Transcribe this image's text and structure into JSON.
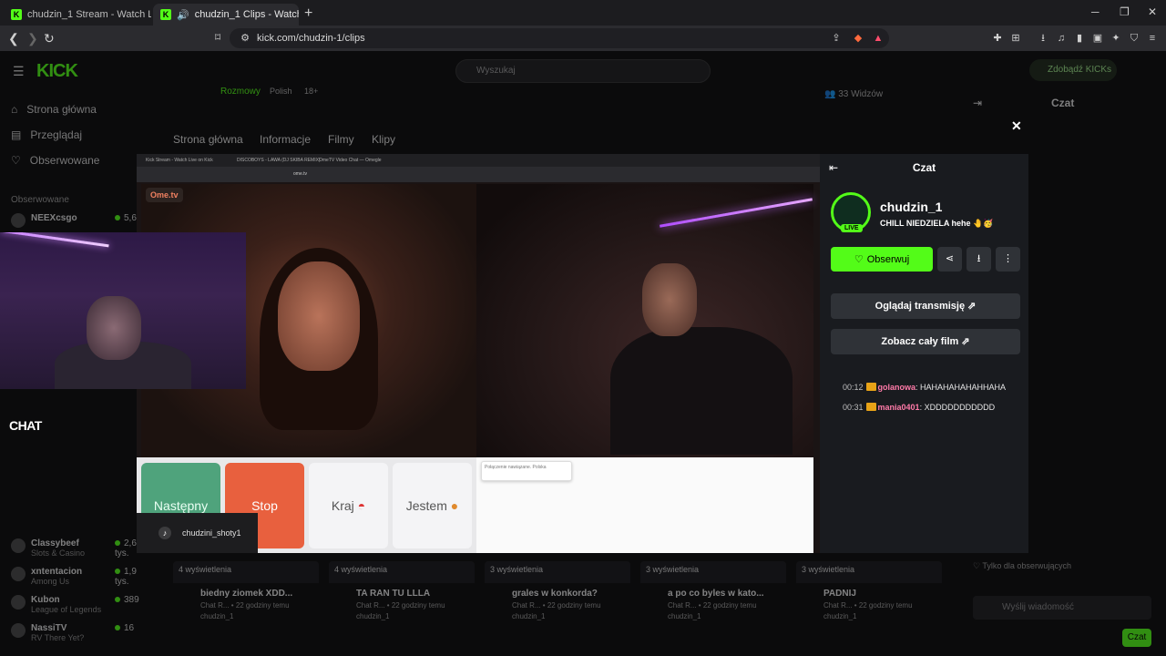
{
  "browser": {
    "tabs": [
      {
        "title": "chudzin_1 Stream - Watch Live on Ki",
        "active": false
      },
      {
        "title": "chudzin_1 Clips - Watch Live",
        "active": true
      }
    ],
    "url": "kick.com/chudzin-1/clips"
  },
  "kick": {
    "logo": "KICK",
    "search_placeholder": "Wyszukaj",
    "get_kicks": "Zdobądź KICKs",
    "nav": [
      "Strona główna",
      "Przeglądaj",
      "Obserwowane"
    ],
    "followed_heading": "Obserwowane",
    "followed": [
      {
        "name": "NEEXcsgo",
        "category": "",
        "viewers": "5,6 ty"
      },
      {
        "name": "Classybeef",
        "category": "Slots & Casino",
        "viewers": "2,6 tys."
      },
      {
        "name": "xntentacion",
        "category": "Among Us",
        "viewers": "1,9 tys."
      },
      {
        "name": "Kubon",
        "category": "League of Legends",
        "viewers": "389"
      },
      {
        "name": "NassiTV",
        "category": "RV There Yet?",
        "viewers": "16"
      }
    ],
    "channel_tags": [
      "Rozmowy",
      "Polish",
      "18+"
    ],
    "viewers": "33 Widzów",
    "channel_tabs": [
      "Strona główna",
      "Informacje",
      "Filmy",
      "Klipy"
    ],
    "chat_heading": "Czat",
    "clips": [
      {
        "views": "4 wyświetlenia",
        "title": "biedny ziomek XDD...",
        "meta": "Chat R... • 22 godziny temu",
        "author": "chudzin_1"
      },
      {
        "views": "4 wyświetlenia",
        "title": "TA RAN TU LLLA",
        "meta": "Chat R... • 22 godziny temu",
        "author": "chudzin_1"
      },
      {
        "views": "3 wyświetlenia",
        "title": "grales w konkorda?",
        "meta": "Chat R... • 22 godziny temu",
        "author": "chudzin_1"
      },
      {
        "views": "3 wyświetlenia",
        "title": "a po co byles w kato...",
        "meta": "Chat R... • 22 godziny temu",
        "author": "chudzin_1"
      },
      {
        "views": "3 wyświetlenia",
        "title": "PADNIJ",
        "meta": "Chat R... • 22 godziny temu",
        "author": "chudzin_1"
      }
    ],
    "chat_input_placeholder": "Wyślij wiadomość",
    "chat_send": "Czat",
    "followers_only": "Tylko dla obserwujących"
  },
  "stream": {
    "inner_tabs": [
      "Kick Stream - Watch Live on Kick",
      "DISCOBOYS - LAWA (DJ SKIBA REMIX)",
      "OmeTV Video Chat — Omegle"
    ],
    "inner_url": "ome.tv",
    "ome_logo": "Ome.tv",
    "buttons": {
      "next": "Następny",
      "stop": "Stop",
      "country": "Kraj",
      "gender": "Jestem"
    },
    "message": "Połączenie nawiązane. Polska",
    "overlay_chat": "CHAT",
    "tiktok": "chudzini_shoty1"
  },
  "clip_panel": {
    "title": "Czat",
    "channel_name": "chudzin_1",
    "stream_title": "CHILL NIEDZIELA hehe 🤚🥳",
    "live_badge": "LIVE",
    "follow": "Obserwuj",
    "watch_stream": "Oglądaj transmisję",
    "see_full": "Zobacz cały film",
    "messages": [
      {
        "time": "00:12",
        "user": "golanowa",
        "text": ": HAHAHAHAHAHHAHA"
      },
      {
        "time": "00:31",
        "user": "mania0401",
        "text": ": XDDDDDDDDDDD"
      }
    ]
  },
  "colors": {
    "brand": "#53fc18",
    "panel": "#191b1f",
    "stop": "#e8603e",
    "next": "#4fa37c"
  }
}
